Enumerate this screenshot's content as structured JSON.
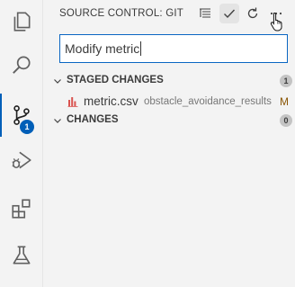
{
  "activity_bar": {
    "items": [
      {
        "name": "explorer-icon"
      },
      {
        "name": "search-icon"
      },
      {
        "name": "source-control-icon",
        "active": true,
        "badge": "1"
      },
      {
        "name": "run-debug-icon"
      },
      {
        "name": "extensions-icon"
      },
      {
        "name": "testing-icon"
      }
    ]
  },
  "sidebar": {
    "title": "SOURCE CONTROL: GIT",
    "toolbar": [
      "view-as-tree-icon",
      "commit-check-icon",
      "refresh-icon",
      "more-actions-icon"
    ]
  },
  "commit": {
    "message": "Modify metric"
  },
  "staged": {
    "label": "STAGED CHANGES",
    "count": "1",
    "files": [
      {
        "name": "metric.csv",
        "path": "obstacle_avoidance_results",
        "status": "M"
      }
    ]
  },
  "changes": {
    "label": "CHANGES",
    "count": "0"
  },
  "colors": {
    "accent": "#005fb8",
    "modified": "#895503"
  }
}
